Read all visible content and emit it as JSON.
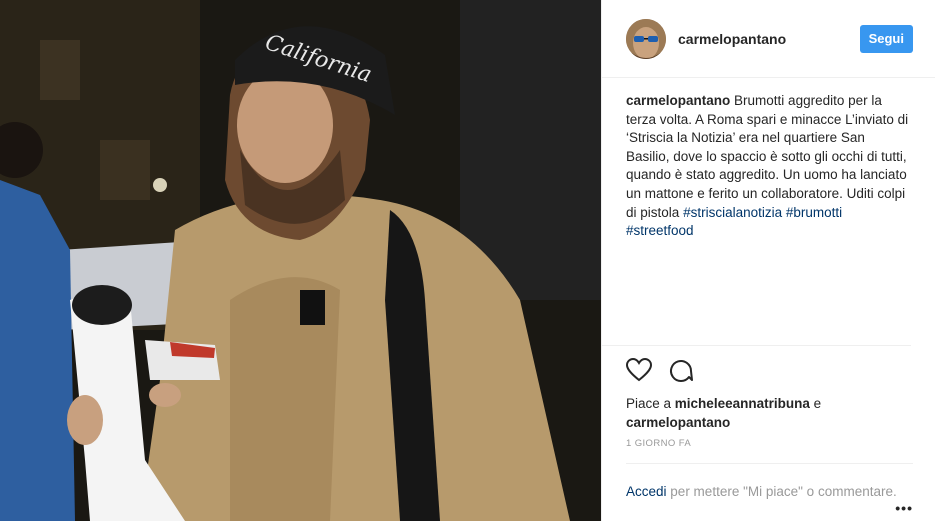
{
  "post": {
    "username": "carmelopantano",
    "follow_label": "Segui",
    "caption": {
      "author": "carmelopantano",
      "text": "Brumotti aggredito per la terza volta. A Roma spari e minacce L’inviato di ‘Striscia la Notizia’ era nel quartiere San Basilio, dove lo spaccio è sotto gli occhi di tutti, quando è stato aggredito. Un uomo ha lanciato un mattone e ferito un collaboratore. Uditi colpi di pistola",
      "hashtags": [
        "#striscialanotizia",
        "#brumotti",
        "#streetfood"
      ]
    },
    "likes": {
      "prefix": "Piace a",
      "user1": "micheleeannatribuna",
      "conj": "e",
      "user2": "carmelopantano"
    },
    "time": "1 GIORNO FA",
    "login_prompt": {
      "link": "Accedi",
      "text": "per mettere \"Mi piace\" o commentare."
    },
    "more_label": "•••",
    "icons": [
      "heart-icon",
      "comment-icon",
      "more-options-icon"
    ],
    "hat_text": "California",
    "colors": {
      "accent": "#3897f0",
      "hashtag": "#003569",
      "muted": "#999999"
    }
  }
}
